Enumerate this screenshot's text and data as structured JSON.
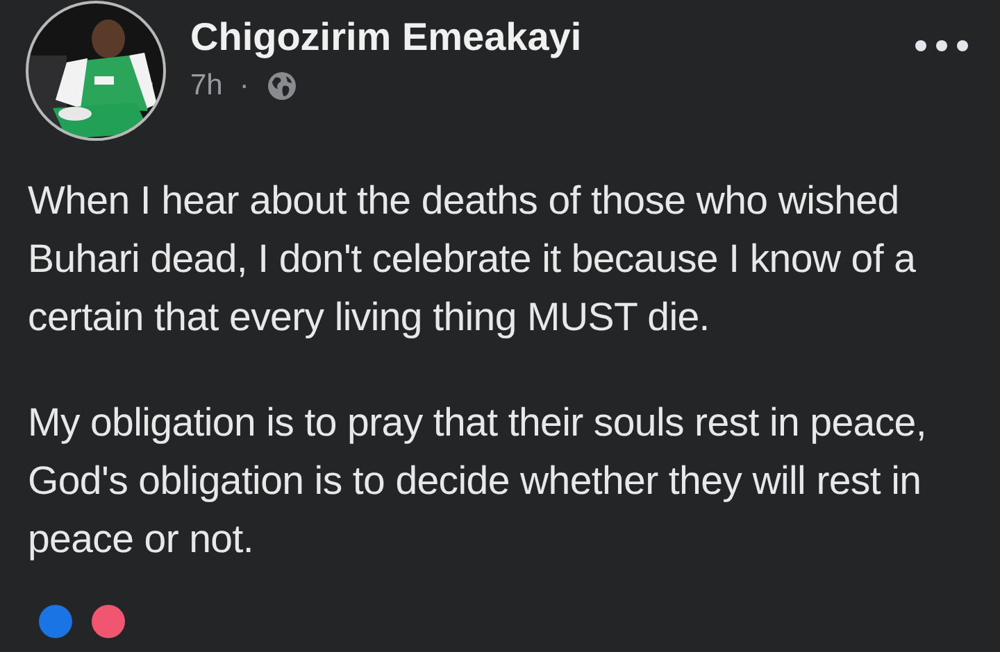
{
  "post": {
    "author": "Chigozirim Emeakayi",
    "time": "7h",
    "separator": "·",
    "paragraphs": [
      "When I hear about the deaths of those who wished Buhari dead, I don't celebrate it because I know of a certain that every living thing MUST die.",
      "My obligation is to pray that their souls rest in peace, God's obligation is to decide whether they will rest in peace or not."
    ]
  }
}
